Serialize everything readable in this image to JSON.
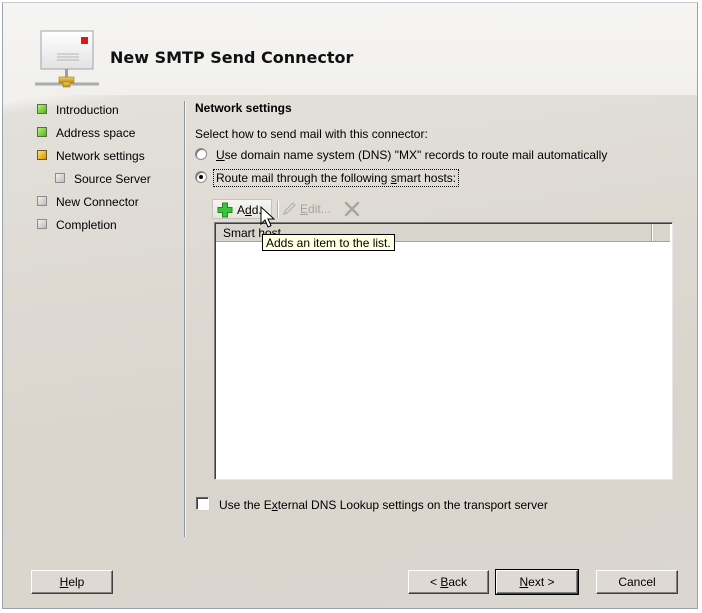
{
  "wizard": {
    "title": "New SMTP Send Connector",
    "header_icon": "smtp-connector-icon"
  },
  "nav": {
    "items": [
      {
        "label": "Introduction",
        "status": "done",
        "indent": 0
      },
      {
        "label": "Address space",
        "status": "done",
        "indent": 0
      },
      {
        "label": "Network settings",
        "status": "current",
        "indent": 0
      },
      {
        "label": "Source Server",
        "status": "pending",
        "indent": 1
      },
      {
        "label": "New Connector",
        "status": "pending",
        "indent": 0
      },
      {
        "label": "Completion",
        "status": "pending",
        "indent": 0
      }
    ]
  },
  "page": {
    "section_title": "Network settings",
    "prompt": "Select how to send mail with this connector:",
    "options": [
      {
        "accesskey": "U",
        "rest": "se domain name system (DNS) \"MX\" records to route mail automatically",
        "checked": false
      },
      {
        "before": "Route mail through the following ",
        "accesskey": "s",
        "after": "mart hosts:",
        "checked": true
      }
    ],
    "toolbar": {
      "add": {
        "before": "A",
        "accesskey": "d",
        "after": "d...",
        "icon": "plus-icon",
        "enabled": true
      },
      "edit": {
        "accesskey": "E",
        "after": "dit...",
        "icon": "pencil-icon",
        "enabled": false
      },
      "delete": {
        "icon": "delete-x-icon",
        "enabled": false
      }
    },
    "list": {
      "columns": [
        "Smart host"
      ],
      "rows": []
    },
    "tooltip": "Adds an item to the list.",
    "external_dns": {
      "before": "Use the E",
      "accesskey": "x",
      "after": "ternal DNS Lookup settings on the transport server",
      "checked": false
    }
  },
  "buttons": {
    "help": {
      "accesskey": "H",
      "rest": "elp"
    },
    "back": {
      "prefix": "< ",
      "accesskey": "B",
      "rest": "ack"
    },
    "next": {
      "accesskey": "N",
      "rest": "ext >"
    },
    "cancel": {
      "label": "Cancel"
    }
  }
}
